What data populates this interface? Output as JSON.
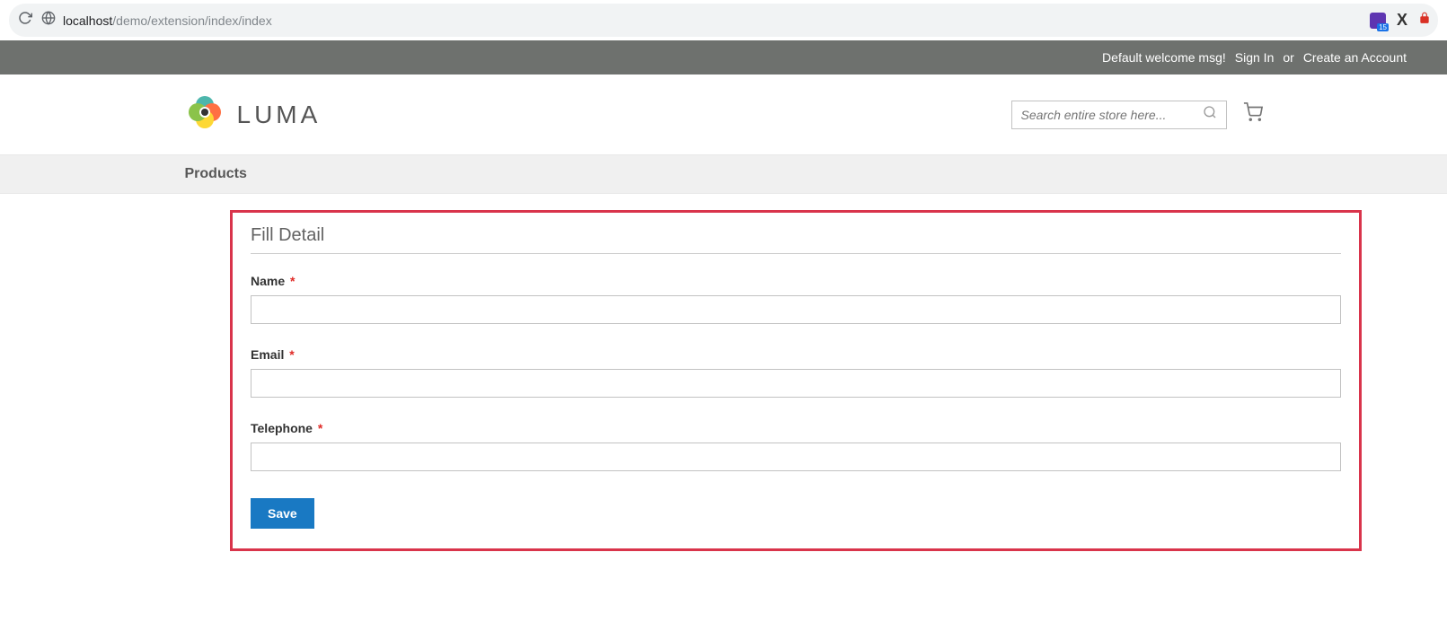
{
  "browser": {
    "url_host": "localhost",
    "url_path": "/demo/extension/index/index"
  },
  "top_panel": {
    "welcome": "Default welcome msg!",
    "sign_in": "Sign In",
    "or": "or",
    "create_account": "Create an Account"
  },
  "header": {
    "logo_text": "LUMA",
    "search_placeholder": "Search entire store here..."
  },
  "nav": {
    "item1": "Products"
  },
  "form": {
    "legend": "Fill Detail",
    "fields": {
      "name": {
        "label": "Name",
        "value": ""
      },
      "email": {
        "label": "Email",
        "value": ""
      },
      "telephone": {
        "label": "Telephone",
        "value": ""
      }
    },
    "save_label": "Save"
  }
}
